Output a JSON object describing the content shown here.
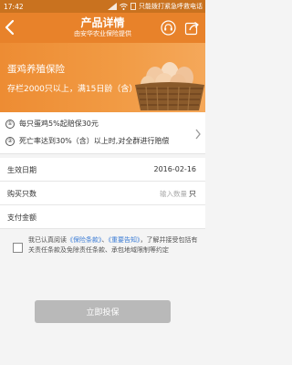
{
  "status_bar": {
    "time": "17:42",
    "notice": "只能拨打紧急呼救电话"
  },
  "header": {
    "title": "产品详情",
    "subtitle": "由安华农业保险提供"
  },
  "banner": {
    "product_name": "蛋鸡养殖保险",
    "description": "存栏2000只以上，满15日龄（含）以上"
  },
  "terms": [
    {
      "index": "①",
      "text": "每只蛋鸡5%起赔保30元"
    },
    {
      "index": "②",
      "text": "死亡率达到30%（含）以上时,对全群进行赔偿"
    }
  ],
  "form": {
    "effective_date_label": "生效日期",
    "effective_date_value": "2016-02-16",
    "quantity_label": "购买只数",
    "quantity_placeholder": "输入数量",
    "quantity_unit": "只",
    "payment_label": "支付金额",
    "payment_value": ""
  },
  "agreement": {
    "prefix": "我已认真阅读",
    "link1": "《保险条款》",
    "joiner": "、",
    "link2": "《重要告知》",
    "suffix": "，了解并接受包括有关责任条款及免除责任条款、承包地域限制等约定"
  },
  "submit_label": "立即投保",
  "colors": {
    "header": "#e8822a",
    "status_bar": "#c9721f",
    "link": "#3a7bd5",
    "submit_disabled": "#b9b9b9"
  },
  "icons": [
    "back-arrow-icon",
    "customer-service-icon",
    "share-icon",
    "chevron-right-icon",
    "egg-basket-image"
  ]
}
